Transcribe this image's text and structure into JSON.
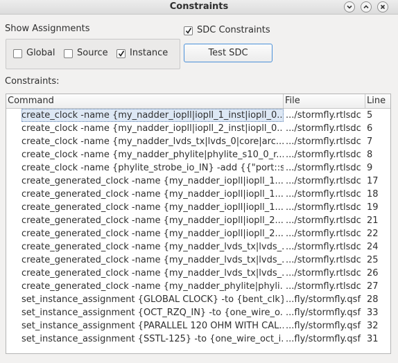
{
  "window": {
    "title": "Constraints"
  },
  "show_assignments": {
    "label": "Show Assignments",
    "options": [
      {
        "label": "Global",
        "checked": false
      },
      {
        "label": "Source",
        "checked": false
      },
      {
        "label": "Instance",
        "checked": true
      }
    ]
  },
  "sdc_constraints": {
    "label": "SDC Constraints",
    "checked": true
  },
  "test_sdc_button": {
    "label": "Test SDC"
  },
  "constraints_label": "Constraints:",
  "table": {
    "headers": {
      "command": "Command",
      "file": "File",
      "line": "Line"
    },
    "rows": [
      {
        "command": "create_clock -name {my_nadder_iopll|iopll_1_inst|iopll_0...",
        "file": ".../stormfly.rtlsdc",
        "line": "5"
      },
      {
        "command": "create_clock -name {my_nadder_iopll|iopll_2_inst|iopll_0...",
        "file": ".../stormfly.rtlsdc",
        "line": "6"
      },
      {
        "command": "create_clock -name {my_nadder_lvds_tx|lvds_0|core|arc...",
        "file": ".../stormfly.rtlsdc",
        "line": "7"
      },
      {
        "command": "create_clock -name {my_nadder_phylite|phylite_s10_0_r...",
        "file": ".../stormfly.rtlsdc",
        "line": "8"
      },
      {
        "command": "create_clock -name {phylite_strobe_io_IN} -add {{\"port::st...",
        "file": ".../stormfly.rtlsdc",
        "line": "9"
      },
      {
        "command": "create_generated_clock -name {my_nadder_iopll|iopll_1...",
        "file": ".../stormfly.rtlsdc",
        "line": "17"
      },
      {
        "command": "create_generated_clock -name {my_nadder_iopll|iopll_1...",
        "file": ".../stormfly.rtlsdc",
        "line": "18"
      },
      {
        "command": "create_generated_clock -name {my_nadder_iopll|iopll_1...",
        "file": ".../stormfly.rtlsdc",
        "line": "19"
      },
      {
        "command": "create_generated_clock -name {my_nadder_iopll|iopll_2...",
        "file": ".../stormfly.rtlsdc",
        "line": "21"
      },
      {
        "command": "create_generated_clock -name {my_nadder_iopll|iopll_2...",
        "file": ".../stormfly.rtlsdc",
        "line": "22"
      },
      {
        "command": "create_generated_clock -name {my_nadder_lvds_tx|lvds_...",
        "file": ".../stormfly.rtlsdc",
        "line": "24"
      },
      {
        "command": "create_generated_clock -name {my_nadder_lvds_tx|lvds_...",
        "file": ".../stormfly.rtlsdc",
        "line": "25"
      },
      {
        "command": "create_generated_clock -name {my_nadder_lvds_tx|lvds_...",
        "file": ".../stormfly.rtlsdc",
        "line": "26"
      },
      {
        "command": "create_generated_clock -name {my_nadder_phylite|phyli...",
        "file": ".../stormfly.rtlsdc",
        "line": "27"
      },
      {
        "command": "set_instance_assignment {GLOBAL CLOCK} -to {bent_clk}...",
        "file": "...fly/stormfly.qsf",
        "line": "28"
      },
      {
        "command": "set_instance_assignment {OCT_RZQ_IN} -to {one_wire_o...",
        "file": "...fly/stormfly.qsf",
        "line": "33"
      },
      {
        "command": "set_instance_assignment {PARALLEL 120 OHM WITH CAL...",
        "file": "...fly/stormfly.qsf",
        "line": "32"
      },
      {
        "command": "set_instance_assignment {SSTL-125} -to {one_wire_oct_i...",
        "file": "...fly/stormfly.qsf",
        "line": "31"
      }
    ],
    "selected_index": 0
  },
  "icons": {
    "minimize": "chevron-down-icon",
    "maximize": "chevron-up-icon",
    "close": "close-icon",
    "check": "check-icon"
  }
}
